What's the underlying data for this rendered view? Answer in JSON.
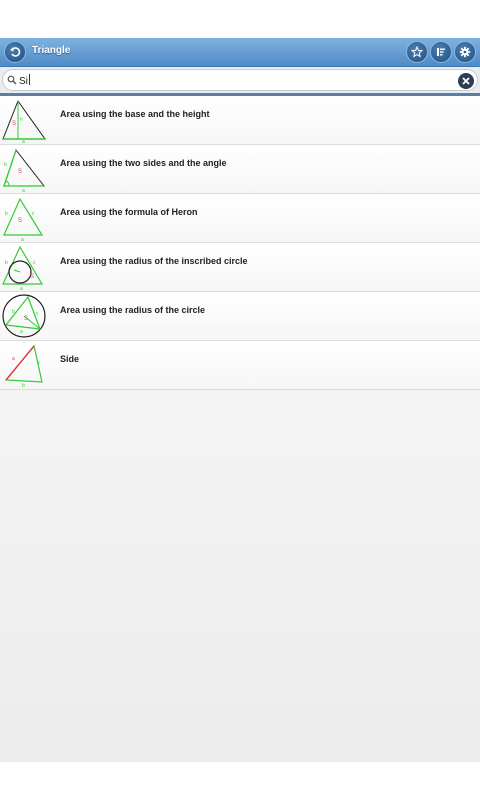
{
  "header": {
    "title": "Triangle",
    "back_icon": "back-arrow-icon",
    "actions": [
      "star-icon",
      "list-icon",
      "gear-icon"
    ]
  },
  "search": {
    "value": "Si",
    "search_icon": "search-icon",
    "clear_icon": "close-icon"
  },
  "results": [
    {
      "label": "Area using the base and the height",
      "icon": "triangle-base-height-icon"
    },
    {
      "label": "Area using the two sides and the angle",
      "icon": "triangle-two-sides-angle-icon"
    },
    {
      "label": "Area using the formula of Heron",
      "icon": "triangle-heron-icon"
    },
    {
      "label": "Area using the radius of the inscribed circle",
      "icon": "triangle-inscribed-circle-icon"
    },
    {
      "label": "Area using the radius of the circle",
      "icon": "triangle-circumscribed-circle-icon"
    },
    {
      "label": "Side",
      "icon": "triangle-side-icon"
    }
  ],
  "colors": {
    "header_top": "#7fb2e0",
    "header_bottom": "#4f8bc7",
    "shape_green": "#33cc33",
    "shape_red": "#e23b3b"
  }
}
